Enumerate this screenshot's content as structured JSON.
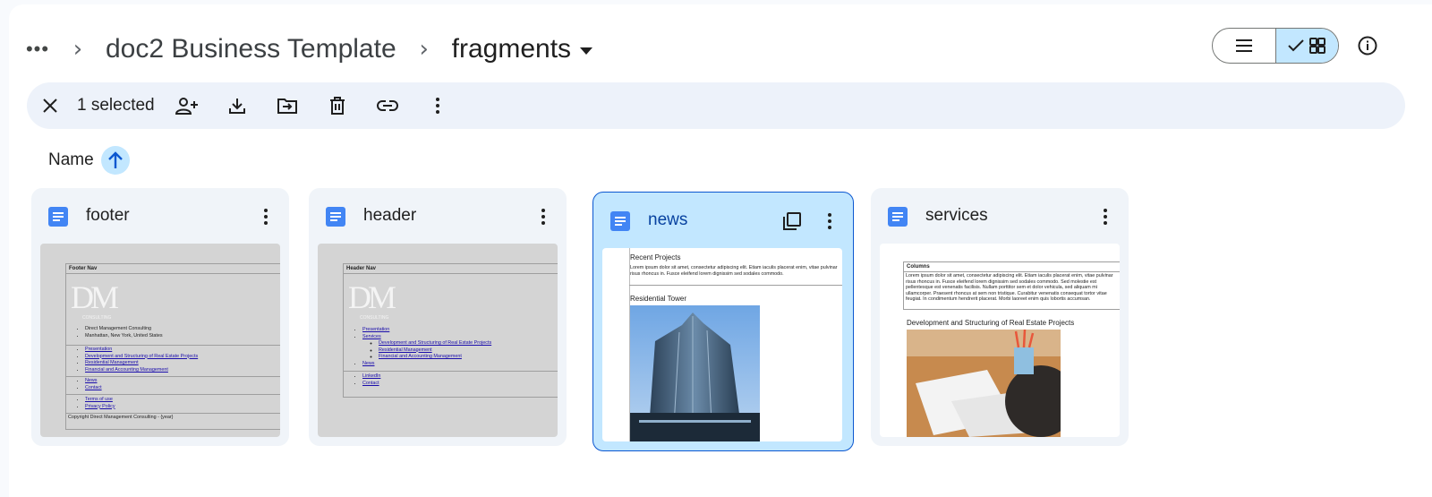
{
  "breadcrumb": {
    "parent": "doc2 Business Template",
    "current": "fragments"
  },
  "selection": {
    "count_label": "1 selected"
  },
  "sort": {
    "label": "Name"
  },
  "files": [
    {
      "title": "footer",
      "preview": {
        "heading": "Footer Nav",
        "company": "Direct Management Consulting",
        "location": "Manhattan, New York, United States",
        "links_a": [
          "Presentation",
          "Development and Structuring of Real Estate Projects",
          "Residential Management",
          "Financial and Accounting Management"
        ],
        "links_b": [
          "News",
          "Contact"
        ],
        "links_c": [
          "Terms of use",
          "Privacy Policy"
        ],
        "copyright": "Copyright Direct Management Consulting - {year}"
      }
    },
    {
      "title": "header",
      "preview": {
        "heading": "Header Nav",
        "link1": "Presentation",
        "link2": "Services",
        "sub_links": [
          "Development and Structuring of Real Estate Projects",
          "Residential Management",
          "Financial and Accounting Management"
        ],
        "link3": "News",
        "link4": "LinkedIn",
        "link5": "Contact"
      }
    },
    {
      "title": "news",
      "preview": {
        "heading": "Recent Projects",
        "body": "Lorem ipsum dolor sit amet, consectetur adipiscing elit. Etiam iaculis placerat enim, vitae pulvinar risus rhoncus in. Fusce eleifend lorem dignissim sed sodales commodo.",
        "subheading": "Residential Tower"
      }
    },
    {
      "title": "services",
      "preview": {
        "heading": "Columns",
        "body": "Lorem ipsum dolor sit amet, consectetur adipiscing elit. Etiam iaculis placerat enim, vitae pulvinar risus rhoncus in. Fusce eleifend lorem dignissim sed sodales commodo. Sed molestie est pellentesque est venenatis facilisis. Nullam porttitor sem et dolor vehicula, sed aliquam mi ullamcorper. Praesent rhoncus at sem non tristique. Curabitur venenatis consequat tortor vitae feugiat. In condimentum hendrerit placerat. Morbi laoreet enim quis lobortis accumsan.",
        "subheading": "Development and Structuring of Real Estate Projects"
      }
    }
  ],
  "logo": {
    "letters": "DM",
    "tagline": "CONSULTING"
  },
  "colors": {
    "accent": "#0b57d0",
    "selected_bg": "#c2e7ff",
    "toolbar_bg": "#edf2fa",
    "card_bg": "#f0f4f9",
    "doc_blue": "#4285f4"
  },
  "icons": {
    "toolbar": [
      "close-icon",
      "share-icon",
      "download-icon",
      "move-icon",
      "trash-icon",
      "link-icon",
      "more-vert-icon"
    ],
    "view": [
      "list-view-icon",
      "grid-view-icon",
      "info-icon"
    ]
  }
}
